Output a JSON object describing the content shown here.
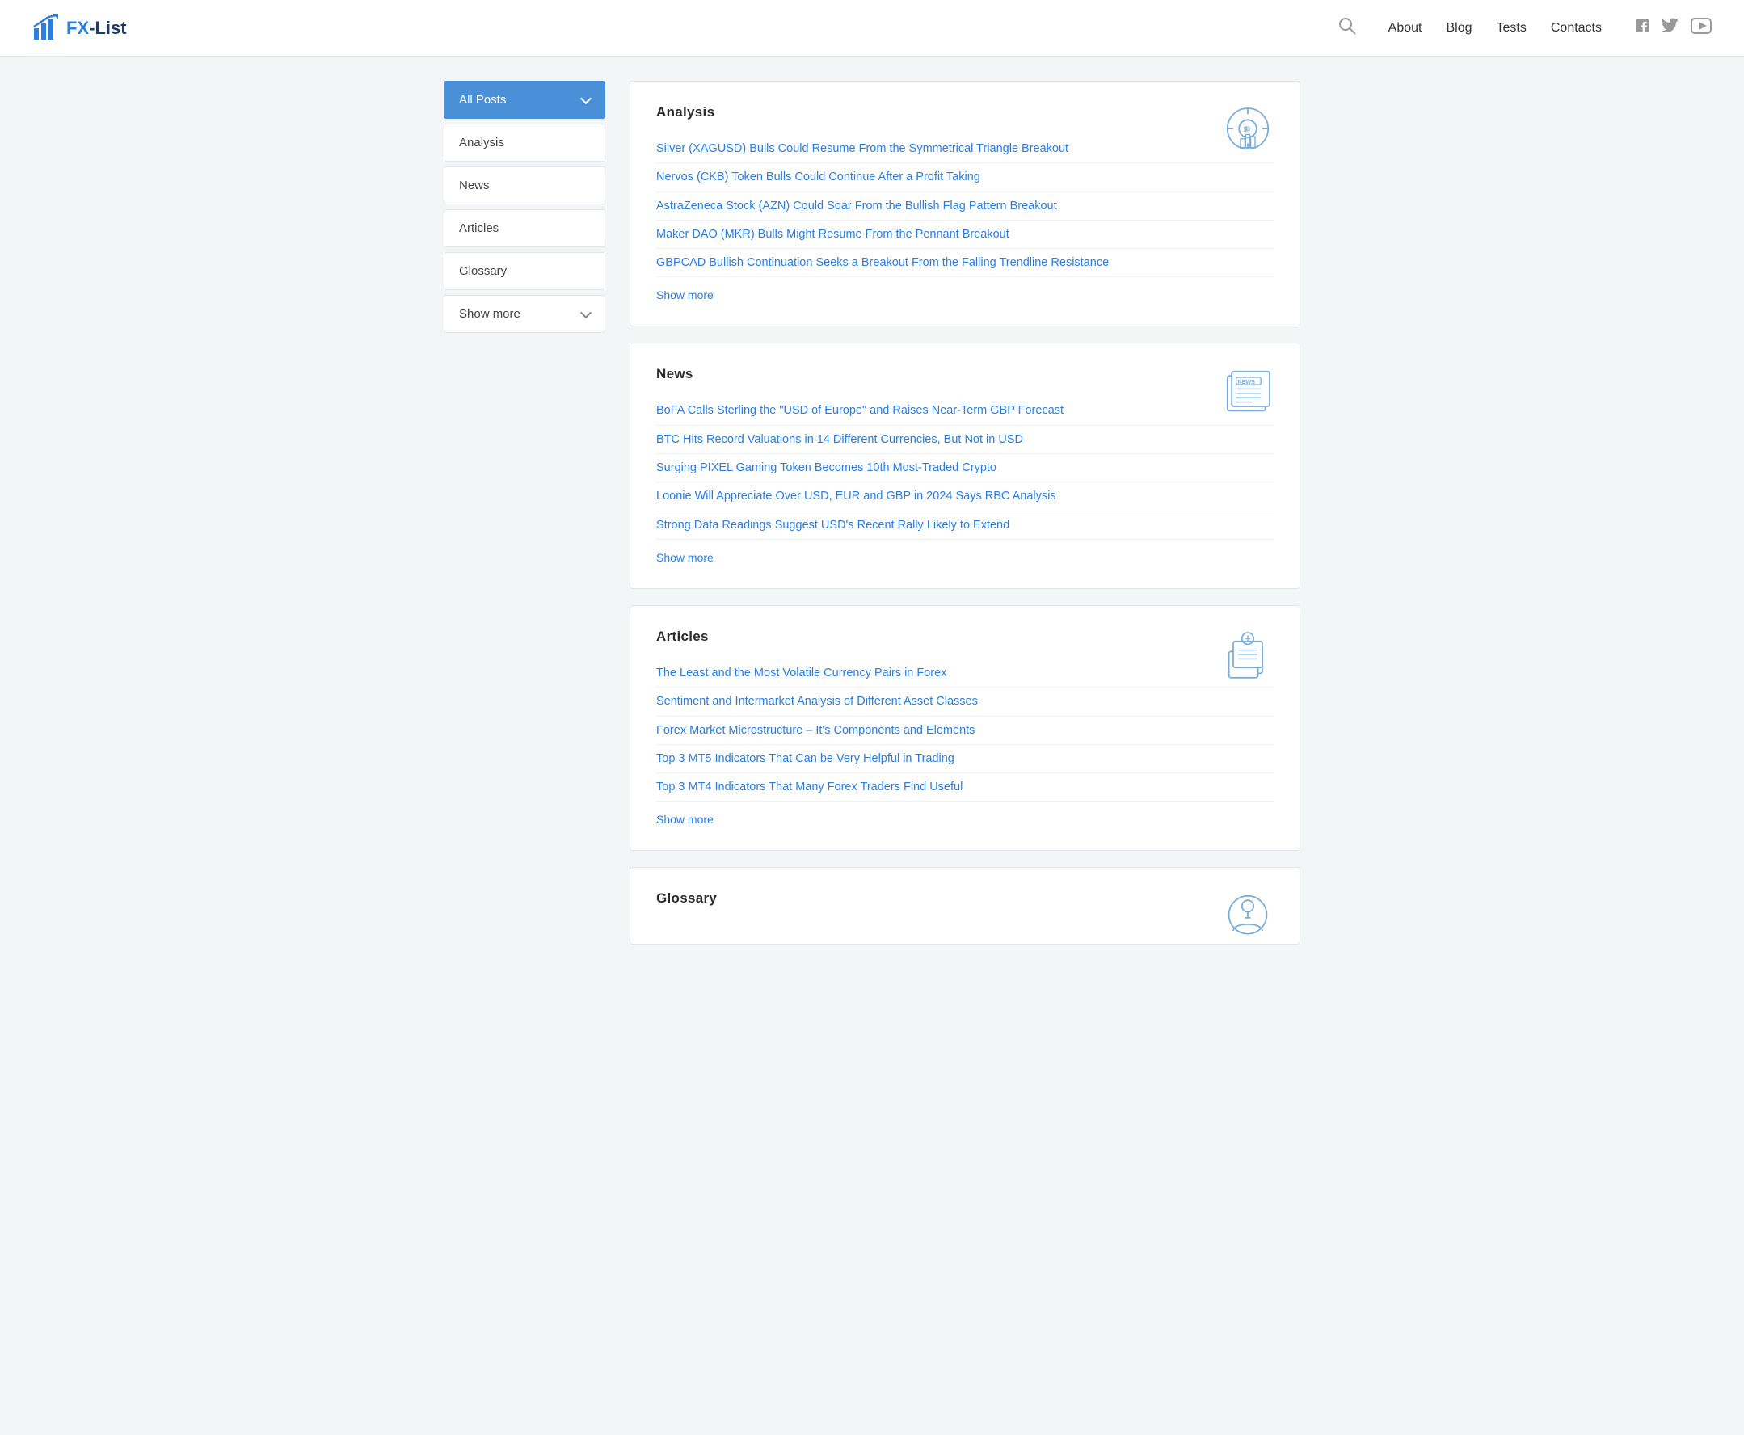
{
  "header": {
    "logo_fx": "FX",
    "logo_list": "-List",
    "nav": [
      {
        "label": "About",
        "id": "nav-about"
      },
      {
        "label": "Blog",
        "id": "nav-blog"
      },
      {
        "label": "Tests",
        "id": "nav-tests"
      },
      {
        "label": "Contacts",
        "id": "nav-contacts"
      }
    ]
  },
  "sidebar": {
    "items": [
      {
        "label": "All Posts",
        "active": true,
        "has_chevron": true
      },
      {
        "label": "Analysis",
        "active": false,
        "has_chevron": false
      },
      {
        "label": "News",
        "active": false,
        "has_chevron": false
      },
      {
        "label": "Articles",
        "active": false,
        "has_chevron": false
      },
      {
        "label": "Glossary",
        "active": false,
        "has_chevron": false
      },
      {
        "label": "Show more",
        "active": false,
        "has_chevron": true
      }
    ]
  },
  "sections": [
    {
      "id": "analysis",
      "title": "Analysis",
      "icon_type": "analysis",
      "links": [
        "Silver (XAGUSD) Bulls Could Resume From the Symmetrical Triangle Breakout",
        "Nervos (CKB) Token Bulls Could Continue After a Profit Taking",
        "AstraZeneca Stock (AZN) Could Soar From the Bullish Flag Pattern Breakout",
        "Maker DAO (MKR) Bulls Might Resume From the Pennant Breakout",
        "GBPCAD Bullish Continuation Seeks a Breakout From the Falling Trendline Resistance"
      ],
      "show_more": "Show more"
    },
    {
      "id": "news",
      "title": "News",
      "icon_type": "news",
      "links": [
        "BoFA Calls Sterling the \"USD of Europe\" and Raises Near-Term GBP Forecast",
        "BTC Hits Record Valuations in 14 Different Currencies, But Not in USD",
        "Surging PIXEL Gaming Token Becomes 10th Most-Traded Crypto",
        "Loonie Will Appreciate Over USD, EUR and GBP in 2024 Says RBC Analysis",
        "Strong Data Readings Suggest USD's Recent Rally Likely to Extend"
      ],
      "show_more": "Show more"
    },
    {
      "id": "articles",
      "title": "Articles",
      "icon_type": "articles",
      "links": [
        "The Least and the Most Volatile Currency Pairs in Forex",
        "Sentiment and Intermarket Analysis of Different Asset Classes",
        "Forex Market Microstructure – It's Components and Elements",
        "Top 3 MT5 Indicators That Can be Very Helpful in Trading",
        "Top 3 MT4 Indicators That Many Forex Traders Find Useful"
      ],
      "show_more": "Show more"
    },
    {
      "id": "glossary",
      "title": "Glossary",
      "icon_type": "glossary",
      "links": [],
      "show_more": ""
    }
  ]
}
